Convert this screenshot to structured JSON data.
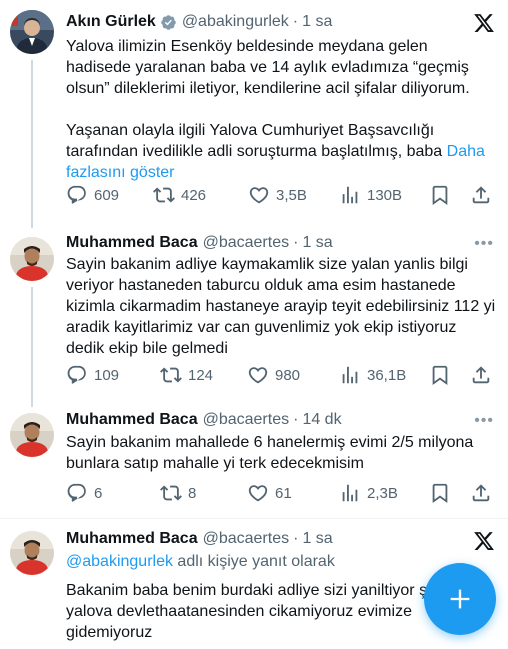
{
  "tweets": [
    {
      "name": "Akın Gürlek",
      "handle": "@abakingurlek",
      "time": "1 sa",
      "para1": "Yalova ilimizin Esenköy beldesinde meydana gelen hadisede yaralanan baba ve 14 aylık evladımıza “geçmiş olsun” dileklerimi iletiyor, kendilerine acil şifalar diliyorum.",
      "para2": "Yaşanan olayla ilgili Yalova Cumhuriyet Başsavcılığı tarafından ivedilikle adli soruşturma başlatılmış, baba",
      "show_more": "Daha fazlasını göster",
      "replies": "609",
      "retweets": "426",
      "likes": "3,5B",
      "views": "130B"
    },
    {
      "name": "Muhammed Baca",
      "handle": "@bacaertes",
      "time": "1 sa",
      "text": "Sayin bakanim adliye kaymakamlik size yalan yanlis bilgi veriyor hastaneden taburcu olduk ama esim hastanede kizimla cikarmadim hastaneye arayip teyit edebilirsiniz 112 yi aradik kayitlarimiz var can guvenlimiz yok ekip istiyoruz dedik ekip bile gelmedi",
      "replies": "109",
      "retweets": "124",
      "likes": "980",
      "views": "36,1B"
    },
    {
      "name": "Muhammed Baca",
      "handle": "@bacaertes",
      "time": "14 dk",
      "text": "Sayin bakanim mahallede 6 hanelermiş evimi 2/5 milyona bunlara satıp mahalle yi terk edecekmisim",
      "replies": "6",
      "retweets": "8",
      "likes": "61",
      "views": "2,3B"
    },
    {
      "name": "Muhammed Baca",
      "handle": "@bacaertes",
      "time": "1 sa",
      "reply_to_handle": "@abakingurlek",
      "reply_to_suffix": " adlı kişiye yanıt olarak",
      "text": "Bakanim baba benim burdaki adliye sizi yaniltiyor şu an yalova devlethaatanesinden cikamiyoruz evimize gidemiyoruz"
    }
  ],
  "colors": {
    "accent": "#1d9bf0",
    "secondary_text": "#536471",
    "primary_text": "#0f1419",
    "verified_badge": "#829aab"
  },
  "icons": [
    "verified-badge-icon",
    "x-logo-icon",
    "more-icon",
    "reply-icon",
    "retweet-icon",
    "like-icon",
    "views-icon",
    "bookmark-icon",
    "share-icon",
    "compose-plus-icon"
  ]
}
